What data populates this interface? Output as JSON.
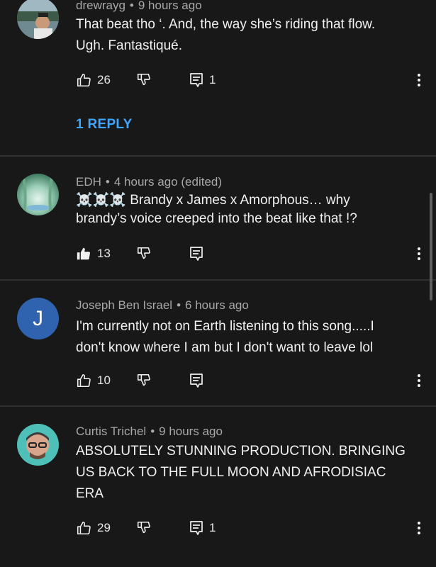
{
  "comments": [
    {
      "author": "drewrayg",
      "time": "9 hours ago",
      "text_lines": [
        "That beat tho ‘. And, the way she’s riding that flow.",
        "Ugh. Fantastiqué."
      ],
      "likes": "26",
      "replies_count": "1",
      "liked": false,
      "reply_button": "1 REPLY"
    },
    {
      "author": "EDH",
      "time": "4 hours ago (edited)",
      "text_lines": [
        "☠️☠️☠️ Brandy x James  x Amorphous… why",
        "brandy’s voice creeped  into the beat like that !?"
      ],
      "likes": "13",
      "replies_count": "",
      "liked": true
    },
    {
      "author": "Joseph Ben Israel",
      "time": "6 hours ago",
      "avatar_letter": "J",
      "text_lines": [
        "I'm currently not on Earth listening to this song.....I",
        "don't know where I am but I don't want to leave lol"
      ],
      "likes": "10",
      "replies_count": "",
      "liked": false
    },
    {
      "author": "Curtis Trichel",
      "time": "9 hours ago",
      "text_lines": [
        "ABSOLUTELY STUNNING PRODUCTION. BRINGING",
        "US BACK TO THE FULL MOON AND AFRODISIAC",
        "ERA"
      ],
      "likes": "29",
      "replies_count": "1",
      "liked": false
    }
  ],
  "colors": {
    "background": "#181818",
    "text": "#f1f1f1",
    "meta": "#a8a8a8",
    "link": "#3ea6ff",
    "divider": "#2f2f2f"
  },
  "icons": [
    "thumbs-up-icon",
    "thumbs-down-icon",
    "reply-comment-icon",
    "more-vert-icon"
  ]
}
